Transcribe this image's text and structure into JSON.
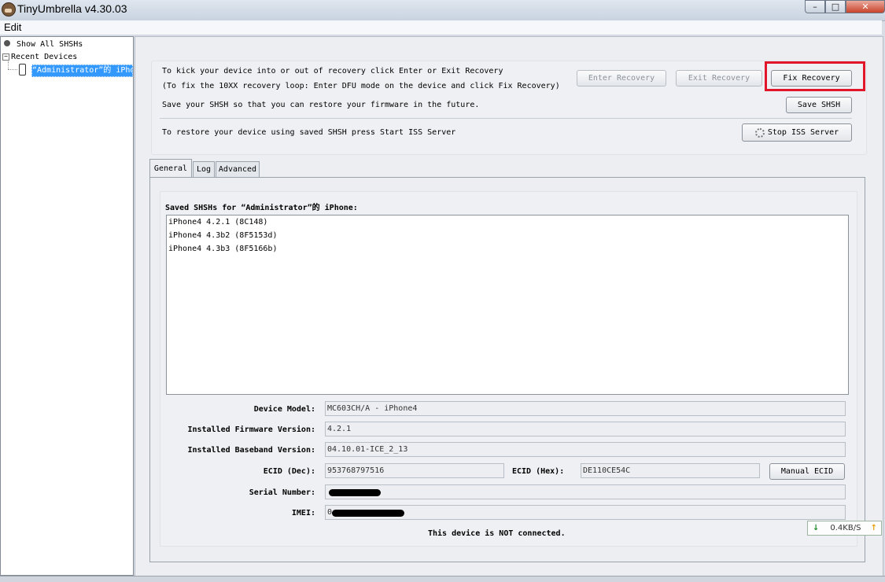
{
  "window": {
    "title": "TinyUmbrella v4.30.03",
    "min": "–",
    "max": "□",
    "close": "✕"
  },
  "menu": {
    "edit": "Edit"
  },
  "sidebar": {
    "show_all": "Show All SHSHs",
    "recent_toggle": "−",
    "recent": "Recent Devices",
    "device": "“Administrator”的 iPhone"
  },
  "recovery": {
    "instructions": "To kick your device into or out of recovery click Enter or Exit Recovery",
    "loop_hint": "(To fix the 10XX recovery loop: Enter DFU mode on the device and click Fix Recovery)",
    "save_hint": "Save your SHSH so that you can restore your firmware in the future.",
    "restore_hint": "To restore your device using saved SHSH press Start ISS Server",
    "enter_label": "Enter Recovery",
    "exit_label": "Exit Recovery",
    "fix_label": "Fix Recovery",
    "save_label": "Save SHSH",
    "iss_label": "Stop ISS Server"
  },
  "tabs": {
    "general": "General",
    "log": "Log",
    "advanced": "Advanced"
  },
  "general": {
    "saved_heading": "Saved SHSHs for “Administrator”的 iPhone:",
    "shsh_list": [
      "iPhone4 4.2.1 (8C148)",
      "iPhone4 4.3b2 (8F5153d)",
      "iPhone4 4.3b3 (8F5166b)"
    ],
    "device_model_label": "Device Model:",
    "device_model": "MC603CH/A - iPhone4",
    "firmware_label": "Installed Firmware Version:",
    "firmware": "4.2.1",
    "baseband_label": "Installed Baseband Version:",
    "baseband": "04.10.01-ICE_2_13",
    "ecid_dec_label": "ECID (Dec):",
    "ecid_dec": "953768797516",
    "ecid_hex_label": "ECID (Hex):",
    "ecid_hex": "DE110CE54C",
    "manual_ecid_label": "Manual ECID",
    "serial_label": "Serial Number:",
    "imei_label": "IMEI:",
    "imei_prefix": "0",
    "status": "This device is NOT connected."
  },
  "netmon": {
    "down_icon": "↓",
    "speed": "0.4KB/S",
    "up_icon": "↑"
  },
  "colors": {
    "highlight": "#e2162a",
    "selection": "#3399ff"
  }
}
